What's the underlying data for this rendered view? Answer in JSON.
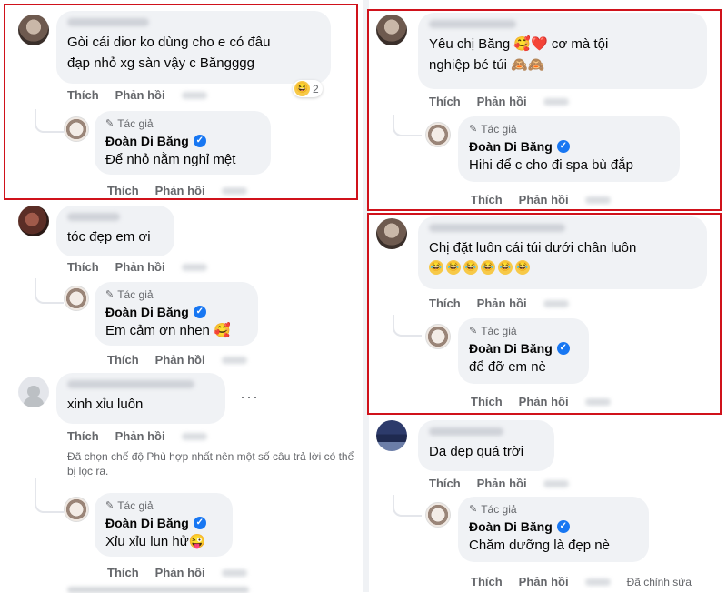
{
  "colors": {
    "highlight_border": "#d0121b",
    "bubble_bg": "#f0f2f5",
    "verified": "#1877f2",
    "meta_text": "#65676b"
  },
  "labels": {
    "like": "Thích",
    "reply": "Phản hồi",
    "author_badge": "Tác giả",
    "edited": "Đã chỉnh sửa"
  },
  "page_name": "Đoàn Di Băng",
  "left": {
    "c1": {
      "text": "Gòi cái dior ko dùng cho e có đâu\nđạp nhỏ xg sàn vậy c Băngggg",
      "reaction_count": "2",
      "reply": "Để nhỏ nằm nghỉ mệt"
    },
    "c2": {
      "text": "tóc đẹp em ơi",
      "reply": "Em cảm ơn nhen 🥰"
    },
    "c3": {
      "text": "xinh xỉu luôn",
      "filter_note": "Đã chọn chế độ Phù hợp nhất nên một số câu trả lời có thể bị lọc ra.",
      "reply": "Xỉu xỉu lun hử😜"
    }
  },
  "right": {
    "c1": {
      "text": "Yêu chị Băng 🥰❤️ cơ mà tội\nnghiệp bé túi 🙈🙈",
      "reply": "Hihi để c cho đi spa bù đắp"
    },
    "c2": {
      "text": "Chị đặt luôn cái túi dưới chân luôn",
      "reply": "để đỡ em nè"
    },
    "c3": {
      "text": "Da đẹp quá trời",
      "reply": "Chăm dưỡng là đẹp nè"
    }
  },
  "icons": {
    "verified": "verified-icon",
    "pen": "pen-icon",
    "more": "more-icon",
    "laugh": "laughing-emoji-icon"
  }
}
